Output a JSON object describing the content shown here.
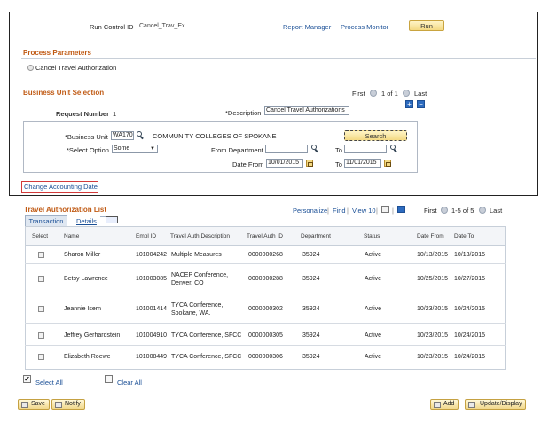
{
  "run_control": {
    "label": "Run Control ID",
    "value": "Cancel_Trav_Ex",
    "report_manager": "Report Manager",
    "process_monitor": "Process Monitor",
    "run_button": "Run"
  },
  "process_parameters": {
    "title": "Process Parameters",
    "option": "Cancel Travel Authorization"
  },
  "bu_selection": {
    "title": "Business Unit Selection",
    "nav_first": "First",
    "nav_range": "1 of 1",
    "nav_last": "Last",
    "request_number_label": "Request Number",
    "request_number_value": "1",
    "description_label": "*Description",
    "description_value": "Cancel Travel Authorizations",
    "business_unit_label": "*Business Unit",
    "business_unit_value": "WA170",
    "business_unit_name": "COMMUNITY COLLEGES OF SPOKANE",
    "search_button": "Search",
    "select_option_label": "*Select Option",
    "select_option_value": "Some",
    "from_department_label": "From Department",
    "from_department_value": "",
    "to_label_dept": "To",
    "to_department_value": "",
    "date_from_label": "Date From",
    "date_from_value": "10/01/2015",
    "to_label_date": "To",
    "date_to_value": "11/01/2015",
    "change_accounting_date": "Change Accounting Date"
  },
  "travel_list": {
    "title": "Travel Authorization List",
    "personalize": "Personalize",
    "find": "Find",
    "view": "View 10",
    "nav_first": "First",
    "nav_range": "1-5 of 5",
    "nav_last": "Last",
    "tabs": [
      "Transaction",
      "Details"
    ],
    "columns": [
      "Select",
      "Name",
      "Empl ID",
      "Travel Auth Description",
      "Travel Auth ID",
      "Department",
      "Status",
      "Date From",
      "Date To"
    ],
    "rows": [
      {
        "name": "Sharon Miller",
        "empl_id": "101004242",
        "desc": "Multiple Measures",
        "auth_id": "0000000268",
        "dept": "35924",
        "status": "Active",
        "date_from": "10/13/2015",
        "date_to": "10/13/2015"
      },
      {
        "name": "Betsy Lawrence",
        "empl_id": "101003085",
        "desc": "NACEP Conference, Denver, CO",
        "auth_id": "0000000288",
        "dept": "35924",
        "status": "Active",
        "date_from": "10/25/2015",
        "date_to": "10/27/2015"
      },
      {
        "name": "Jeannie Isern",
        "empl_id": "101001414",
        "desc": "TYCA Conference, Spokane, WA.",
        "auth_id": "0000000302",
        "dept": "35924",
        "status": "Active",
        "date_from": "10/23/2015",
        "date_to": "10/24/2015"
      },
      {
        "name": "Jeffrey Gerhardstein",
        "empl_id": "101004910",
        "desc": "TYCA Conference, SFCC",
        "auth_id": "0000000305",
        "dept": "35924",
        "status": "Active",
        "date_from": "10/23/2015",
        "date_to": "10/24/2015"
      },
      {
        "name": "Elizabeth Roewe",
        "empl_id": "101008449",
        "desc": "TYCA Conference, SFCC",
        "auth_id": "0000000306",
        "dept": "35924",
        "status": "Active",
        "date_from": "10/23/2015",
        "date_to": "10/24/2015"
      }
    ],
    "select_all": "Select All",
    "clear_all": "Clear All"
  },
  "toolbar": {
    "save": "Save",
    "notify": "Notify",
    "add": "Add",
    "update_display": "Update/Display"
  }
}
